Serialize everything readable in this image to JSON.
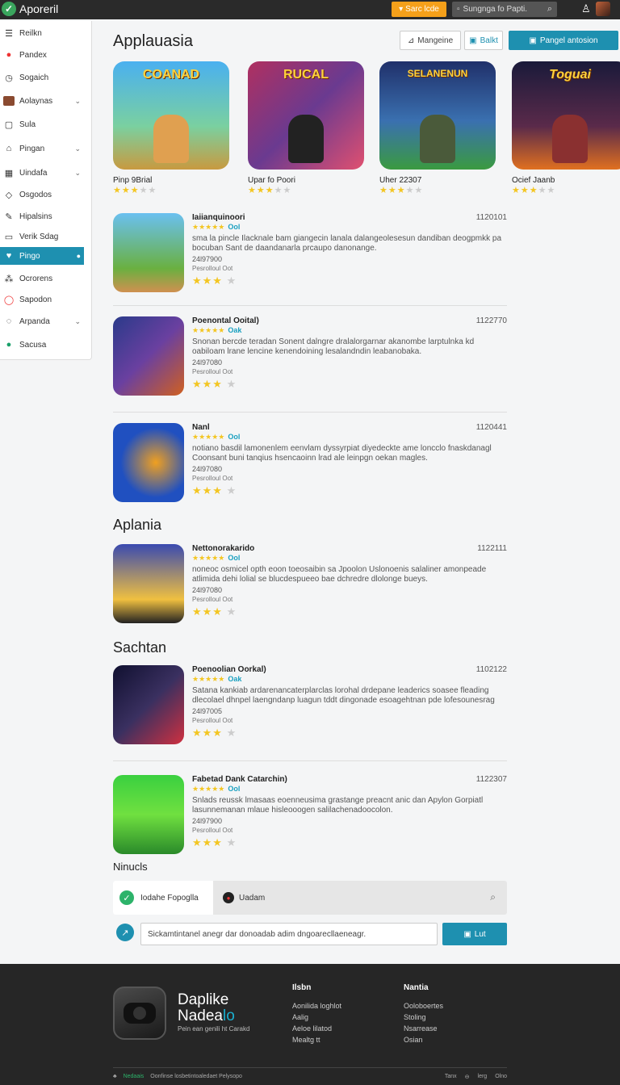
{
  "header": {
    "brand": "Aporeril",
    "cta_label": "Sarc lcde",
    "search_placeholder": "Sungnga fo Papti.",
    "colors": {
      "bar": "#2a2a2a",
      "accent": "#f5a01a",
      "primary": "#1e90b0"
    }
  },
  "sidebar": {
    "items": [
      {
        "label": "Reilkn",
        "icon": "menu-icon"
      },
      {
        "label": "Pandex",
        "icon": "badge-icon"
      },
      {
        "label": "Sogaich",
        "icon": "clock-icon"
      },
      {
        "label": "Aolaynas",
        "icon": "avatar-icon",
        "has_chevron": true
      },
      {
        "label": "Sula",
        "icon": "square-icon"
      },
      {
        "label": "Pingan",
        "icon": "bag-icon",
        "has_chevron": true
      },
      {
        "label": "Uindafa",
        "icon": "grid-icon",
        "has_chevron": true
      },
      {
        "label": "Osgodos",
        "icon": "tag-icon"
      },
      {
        "label": "Hipalsins",
        "icon": "pencil-icon"
      },
      {
        "label": "Verik Sdag",
        "icon": "monitor-icon"
      },
      {
        "label": "Pingo",
        "icon": "heart-icon",
        "active": true
      },
      {
        "label": "Ocrorens",
        "icon": "nodes-icon"
      },
      {
        "label": "Sapodon",
        "icon": "circle-icon"
      },
      {
        "label": "Arpanda",
        "icon": "check-circle-icon",
        "has_chevron": true
      },
      {
        "label": "Sacusa",
        "icon": "dot-icon"
      }
    ]
  },
  "main": {
    "title": "Applauasia",
    "btn_manage": "Mangeine",
    "btn_edit": "Balkt",
    "btn_primary": "Pangel antosion",
    "featured": [
      {
        "name": "Pinp 9Brial",
        "art_text": "COANAD",
        "rating": 3
      },
      {
        "name": "Upar fo Poori",
        "art_text": "RUCAL",
        "rating": 3
      },
      {
        "name": "Uher 22307",
        "art_text": "SELANENUN",
        "rating": 3
      },
      {
        "name": "Ocief Jaanb",
        "art_text": "Toguai",
        "rating": 3
      }
    ],
    "sections": [
      {
        "title": "Aplania"
      },
      {
        "title": "Sachtan"
      },
      {
        "title": "Ninucls"
      }
    ],
    "list": [
      {
        "title": "Iaiianquinoori",
        "code": "1120101",
        "tag": "Ool",
        "desc": "sma la pincle Ilacknale bam giangecin lanala dalangeolesesun dandiban deogpmkk pa bocuban Sant de daandanarla prcaupo danonange.",
        "date": "24l97900",
        "meta": "Pesrolloul Oot",
        "rating": 3
      },
      {
        "title": "Poenontal Ooital)",
        "code": "1122770",
        "tag": "Oak",
        "desc": "Snonan bercde teradan Sonent dalngre dralalorgarnar akanombe larptulnka kd oabiloam lrane lencine kenendoining lesalandndin leabanobaka.",
        "date": "24l97080",
        "meta": "Pesrolloul Oot",
        "rating": 3
      },
      {
        "title": "Nanl",
        "code": "1120441",
        "tag": "Ool",
        "desc": "notiano basdil lamonenlem eenvlam dyssyrpiat diyedeckte ame loncclo fnaskdanagl Coonsant buni tanqius hsencaoinn lrad ale leinpgn oekan magles.",
        "date": "24l97080",
        "meta": "Pesrolloul Oot",
        "rating": 3
      },
      {
        "title": "Nettonorakarido",
        "code": "1122111",
        "tag": "Ool",
        "desc": "noneoc osmicel opth eoon toeosaibin sa Jpoolon Uslonoenis salaliner amonpeade atlimida dehi lolial se blucdespueeo bae dchredre dlolonge bueys.",
        "date": "24l97080",
        "meta": "Pesrolloul Oot",
        "rating": 3
      },
      {
        "title": "Poenoolian Oorkal)",
        "code": "1102122",
        "tag": "Oak",
        "desc": "Satana kankiab ardarenancaterplarclas lorohal drdepane leaderics soasee fleading dlecolael dhnpel laengndanp luagun tddt dingonade esoagehtnan pde lofesounesrag",
        "date": "24l97005",
        "meta": "Pesrolloul Oot",
        "rating": 3
      },
      {
        "title": "Fabetad Dank Catarchin)",
        "code": "1122307",
        "tag": "Ool",
        "desc": "Snlads reussk lmasaas eoenneusima grastange preacnt anic dan Apylon Gorpiatl lasunnemanan mlaue hisleooogen salilachenadoocolon.",
        "date": "24l97900",
        "meta": "Pesrolloul Oot",
        "rating": 3
      }
    ],
    "tabs": {
      "first": "Iodahe Fopoglla",
      "second": "Uadam"
    },
    "comment_placeholder": "Sickamtintanel anegr dar donoadab adim dngoarecllaeneagr.",
    "comment_button": "Lut"
  },
  "footer": {
    "brand_line1": "Daplike",
    "brand_line2_a": "Nadea",
    "brand_line2_b": "lo",
    "tagline": "Pein ean genili ht Carakd",
    "col1": {
      "head": "Ilsbn",
      "items": [
        "Aonilida loghlot",
        "Aalig",
        "Aeloe lilatod",
        "Mealtg tt"
      ]
    },
    "col2": {
      "head": "Nantia",
      "items": [
        "Ooloboertes",
        "Stoling",
        "Nsarrease",
        "Osian"
      ]
    },
    "bottom_left_a": "Nedaais",
    "bottom_left_b": "Oonfinse losbetintoaledaet Pelysopo",
    "bottom_right": [
      "Tanx",
      "lerg",
      "Olno"
    ]
  }
}
